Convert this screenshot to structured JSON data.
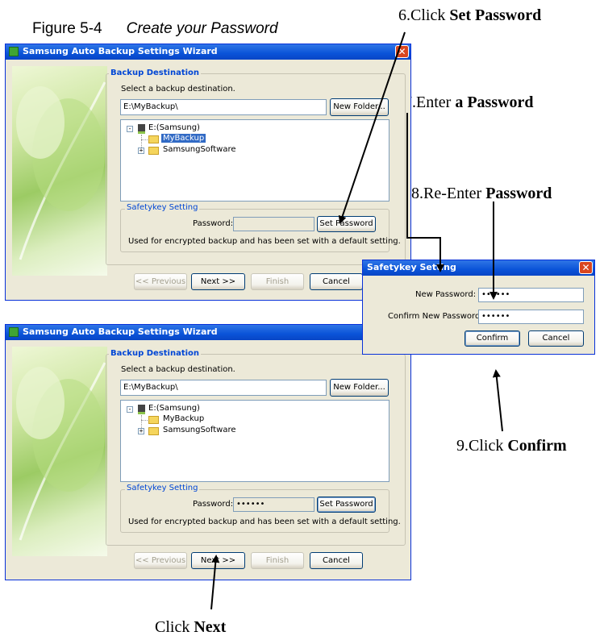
{
  "figure": {
    "number": "Figure 5-4",
    "caption": "Create your Password"
  },
  "callouts": {
    "step6": {
      "prefix": "6.Click ",
      "bold": "Set Password"
    },
    "step7": {
      "prefix": "7.Enter ",
      "bold": "a Password"
    },
    "step8": {
      "prefix": "8.Re-Enter ",
      "bold": "Password"
    },
    "step9": {
      "prefix": "9.Click ",
      "bold": "Confirm"
    },
    "next": {
      "prefix": "Click ",
      "bold": "Next"
    }
  },
  "wizard_top": {
    "title": "Samsung Auto Backup Settings Wizard",
    "close_glyph": "✕",
    "backup_destination": "Backup Destination",
    "select_label": "Select a backup destination.",
    "path_value": "E:\\MyBackup\\",
    "new_folder": "New Folder...",
    "tree": {
      "drive": "E:(Samsung)",
      "folder1": "MyBackup",
      "folder2": "SamsungSoftware"
    },
    "safetykey": "Safetykey Setting",
    "password_label": "Password:",
    "password_value": "",
    "set_password": "Set Password",
    "note": "Used for encrypted backup and has been set with a default setting.",
    "prev": "<< Previous",
    "next": "Next >>",
    "finish": "Finish",
    "cancel": "Cancel"
  },
  "wizard_bottom": {
    "title": "Samsung Auto Backup Settings Wizard",
    "backup_destination": "Backup Destination",
    "select_label": "Select a backup destination.",
    "path_value": "E:\\MyBackup\\",
    "new_folder": "New Folder...",
    "tree": {
      "drive": "E:(Samsung)",
      "folder1": "MyBackup",
      "folder2": "SamsungSoftware"
    },
    "safetykey": "Safetykey Setting",
    "password_label": "Password:",
    "password_value": "••••••",
    "set_password": "Set Password",
    "note": "Used for encrypted backup and has been set with a default setting.",
    "prev": "<< Previous",
    "next": "Next >>",
    "finish": "Finish",
    "cancel": "Cancel"
  },
  "dialog": {
    "title": "Safetykey Setting",
    "close_glyph": "✕",
    "new_password_label": "New Password:",
    "new_password_value": "••••••",
    "confirm_label": "Confirm New Password:",
    "confirm_value": "••••••",
    "confirm_button": "Confirm",
    "cancel_button": "Cancel"
  },
  "colors": {
    "titlebar": "#0a53d8",
    "accent": "#0046d5",
    "selection": "#316ac5"
  }
}
